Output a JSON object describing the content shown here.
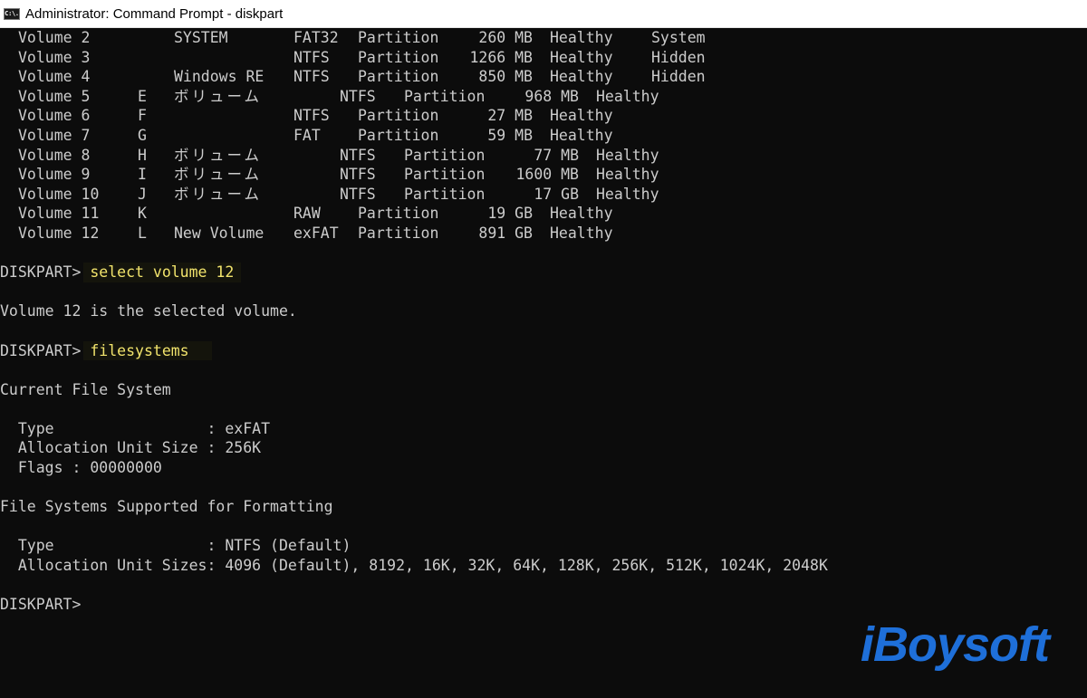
{
  "window": {
    "title": "Administrator: Command Prompt - diskpart",
    "icon_text": "C:\\."
  },
  "volumes": [
    {
      "vol": "Volume 2",
      "ltr": "",
      "label": "SYSTEM",
      "fs": "FAT32",
      "type": "Partition",
      "size": "260 MB",
      "status": "Healthy",
      "info": "System",
      "shift": false
    },
    {
      "vol": "Volume 3",
      "ltr": "",
      "label": "",
      "fs": "NTFS",
      "type": "Partition",
      "size": "1266 MB",
      "status": "Healthy",
      "info": "Hidden",
      "shift": false
    },
    {
      "vol": "Volume 4",
      "ltr": "",
      "label": "Windows RE",
      "fs": "NTFS",
      "type": "Partition",
      "size": "850 MB",
      "status": "Healthy",
      "info": "Hidden",
      "shift": false
    },
    {
      "vol": "Volume 5",
      "ltr": "E",
      "label": "ボリューム",
      "fs": "NTFS",
      "type": "Partition",
      "size": "968 MB",
      "status": "Healthy",
      "info": "",
      "shift": true
    },
    {
      "vol": "Volume 6",
      "ltr": "F",
      "label": "",
      "fs": "NTFS",
      "type": "Partition",
      "size": "27 MB",
      "status": "Healthy",
      "info": "",
      "shift": false
    },
    {
      "vol": "Volume 7",
      "ltr": "G",
      "label": "",
      "fs": "FAT",
      "type": "Partition",
      "size": "59 MB",
      "status": "Healthy",
      "info": "",
      "shift": false
    },
    {
      "vol": "Volume 8",
      "ltr": "H",
      "label": "ボリューム",
      "fs": "NTFS",
      "type": "Partition",
      "size": "77 MB",
      "status": "Healthy",
      "info": "",
      "shift": true
    },
    {
      "vol": "Volume 9",
      "ltr": "I",
      "label": "ボリューム",
      "fs": "NTFS",
      "type": "Partition",
      "size": "1600 MB",
      "status": "Healthy",
      "info": "",
      "shift": true
    },
    {
      "vol": "Volume 10",
      "ltr": "J",
      "label": "ボリューム",
      "fs": "NTFS",
      "type": "Partition",
      "size": "17 GB",
      "status": "Healthy",
      "info": "",
      "shift": true
    },
    {
      "vol": "Volume 11",
      "ltr": "K",
      "label": "",
      "fs": "RAW",
      "type": "Partition",
      "size": "19 GB",
      "status": "Healthy",
      "info": "",
      "shift": false
    },
    {
      "vol": "Volume 12",
      "ltr": "L",
      "label": "New Volume",
      "fs": "exFAT",
      "type": "Partition",
      "size": "891 GB",
      "status": "Healthy",
      "info": "",
      "shift": false
    }
  ],
  "session": {
    "prompt": "DISKPART> ",
    "cmd1": "select volume 12",
    "selected_msg": "Volume 12 is the selected volume.",
    "cmd2": "filesystems",
    "current_header": "Current File System",
    "cur_type": "  Type                 : exFAT",
    "cur_alloc": "  Allocation Unit Size : 256K",
    "cur_flags": "  Flags : 00000000",
    "supported_header": "File Systems Supported for Formatting",
    "sup_type": "  Type                 : NTFS (Default)",
    "sup_alloc": "  Allocation Unit Sizes: 4096 (Default), 8192, 16K, 32K, 64K, 128K, 256K, 512K, 1024K, 2048K",
    "final_prompt": "DISKPART>"
  },
  "watermark": "iBoysoft",
  "colors": {
    "background": "#0c0c0c",
    "text": "#cccccc",
    "command": "#f2e46c",
    "watermark": "#1e6fd9"
  }
}
